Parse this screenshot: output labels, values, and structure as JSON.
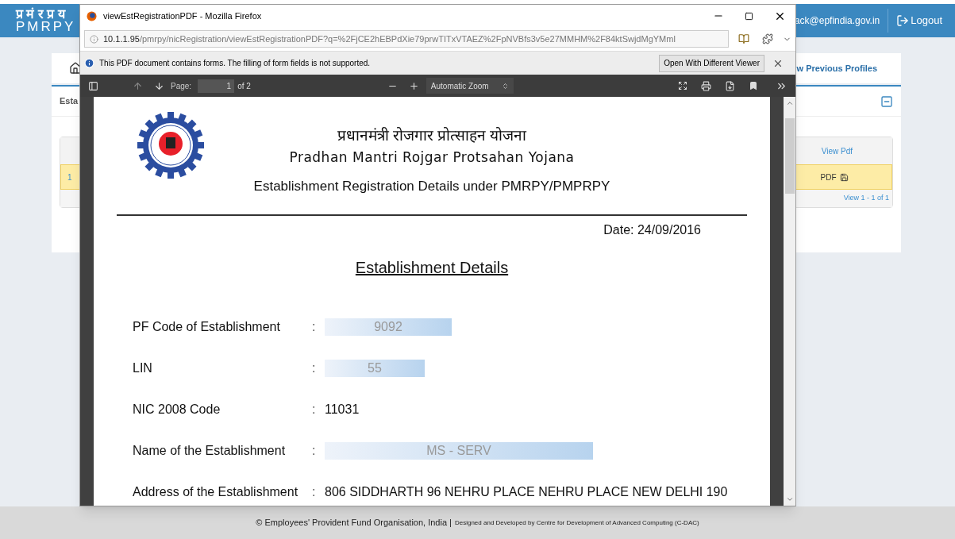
{
  "site": {
    "logo_hindi": "प्र मं र प्र य",
    "logo_latin": "PMRPY",
    "user_email": "ack@epfindia.gov.in",
    "logout": "Logout",
    "nav_link": "w Previous Profiles",
    "panel_title": "Esta",
    "table": {
      "column_header": "View Pdf",
      "rows": [
        {
          "number": "1",
          "pdf_link": "PDF",
          "selected": true
        }
      ],
      "pager": "View 1 - 1 of 1"
    }
  },
  "browser": {
    "title": "viewEstRegistrationPDF - Mozilla Firefox",
    "url_host": "10.1.1.95",
    "url_path": "/pmrpy/nicRegistration/viewEstRegistrationPDF?q=%2FjCE2hEBPdXie79prwTITxVTAEZ%2FpNVBfs3v5e27MMHM%2F84ktSwjdMgYMml",
    "notice": "This PDF document contains forms. The filling of form fields is not supported.",
    "notice_button": "Open With Different Viewer",
    "toolbar": {
      "page_label": "Page:",
      "page_value": "1",
      "page_count": "of 2",
      "zoom": "Automatic Zoom"
    }
  },
  "document": {
    "title_hindi": "प्रधानमंत्री रोजगार प्रोत्साहन योजना",
    "title_english": "Pradhan Mantri Rojgar Protsahan Yojana",
    "heading": "Establishment Registration Details under PMRPY/PMPRPY",
    "date": "Date: 24/09/2016",
    "section": "Establishment Details",
    "fields": [
      {
        "label": "PF Code of Establishment",
        "separator": ":",
        "value": "9092",
        "redacted": true
      },
      {
        "label": "LIN",
        "separator": ":",
        "value": "55",
        "redacted": true
      },
      {
        "label": "NIC 2008 Code",
        "separator": ":",
        "value": "11031",
        "redacted": false
      },
      {
        "label": "Name of the Establishment",
        "separator": ":",
        "value": "MS - SERV",
        "redacted": true
      },
      {
        "label": "Address of the Establishment",
        "separator": ":",
        "value": "806 SIDDHARTH 96 NEHRU PLACE NEHRU PLACE NEW DELHI 190",
        "redacted": false
      }
    ]
  },
  "footer": {
    "copyright": "© Employees' Provident Fund Organisation, India |",
    "credit": "Designed and Developed by Centre for Development of Advanced Computing (C-DAC)"
  }
}
